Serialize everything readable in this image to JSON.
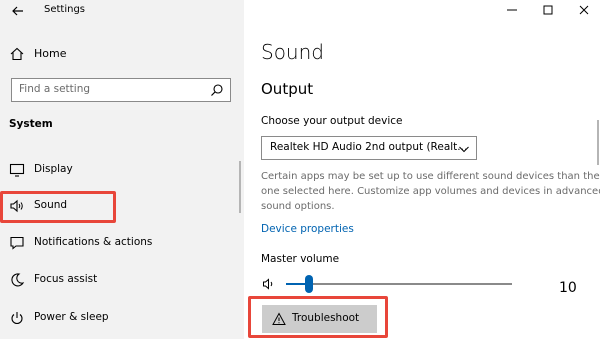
{
  "app": {
    "title": "Settings"
  },
  "sidebar": {
    "home_label": "Home",
    "search_placeholder": "Find a setting",
    "section_title": "System",
    "items": [
      {
        "label": "Display",
        "icon": "display-icon"
      },
      {
        "label": "Sound",
        "icon": "speaker-icon"
      },
      {
        "label": "Notifications & actions",
        "icon": "notifications-icon"
      },
      {
        "label": "Focus assist",
        "icon": "moon-icon"
      },
      {
        "label": "Power & sleep",
        "icon": "power-icon"
      }
    ]
  },
  "main": {
    "title": "Sound",
    "output_heading": "Output",
    "device_label": "Choose your output device",
    "device_selected": "Realtek HD Audio 2nd output (Realt...",
    "description_lines": [
      "Certain apps may be set up to use different sound devices than the",
      "one selected here. Customize app volumes and devices in advanced",
      "sound options."
    ],
    "device_properties_link": "Device properties",
    "master_volume_label": "Master volume",
    "master_volume_value": "10",
    "master_volume_level": 10,
    "troubleshoot_label": "Troubleshoot"
  },
  "colors": {
    "accent": "#0063b1",
    "highlight_box": "#e8463a",
    "sidebar_bg": "#f2f2f2"
  }
}
